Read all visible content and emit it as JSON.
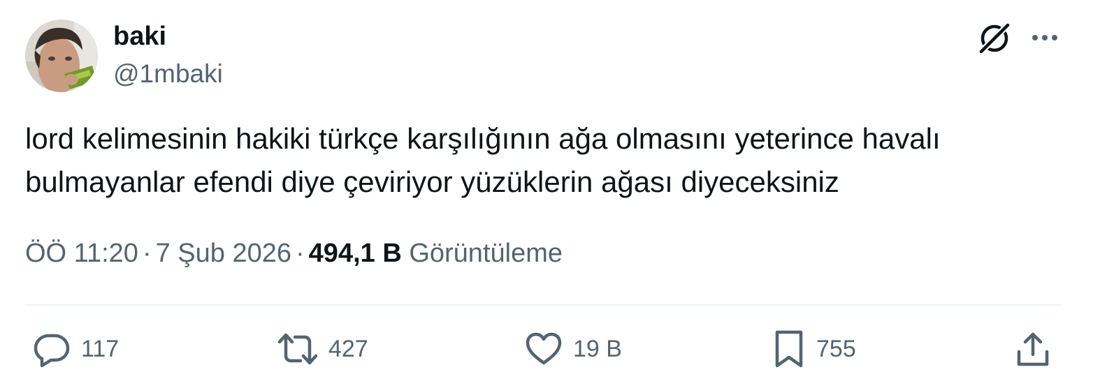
{
  "author": {
    "display_name": "baki",
    "handle": "@1mbaki"
  },
  "header_actions": {
    "grok_icon": "grok-icon",
    "more_icon": "more-icon"
  },
  "tweet": {
    "lines": [
      "lord kelimesinin hakiki türkçe karşılığının ağa olmasını yeterince havalı",
      "bulmayanlar efendi diye çeviriyor yüzüklerin ağası diyeceksiniz"
    ]
  },
  "meta": {
    "time": "ÖÖ 11:20",
    "separator": "·",
    "date": "7 Şub 2026",
    "views_count": "494,1 B",
    "views_label": "Görüntüleme"
  },
  "actions": {
    "reply": {
      "icon": "reply-icon",
      "count": "117"
    },
    "retweet": {
      "icon": "retweet-icon",
      "count": "427"
    },
    "like": {
      "icon": "heart-icon",
      "count": "19 B"
    },
    "bookmark": {
      "icon": "bookmark-icon",
      "count": "755"
    },
    "share": {
      "icon": "share-icon"
    }
  },
  "colors": {
    "text_primary": "#0f1419",
    "text_secondary": "#536471",
    "divider": "#eff3f4"
  }
}
